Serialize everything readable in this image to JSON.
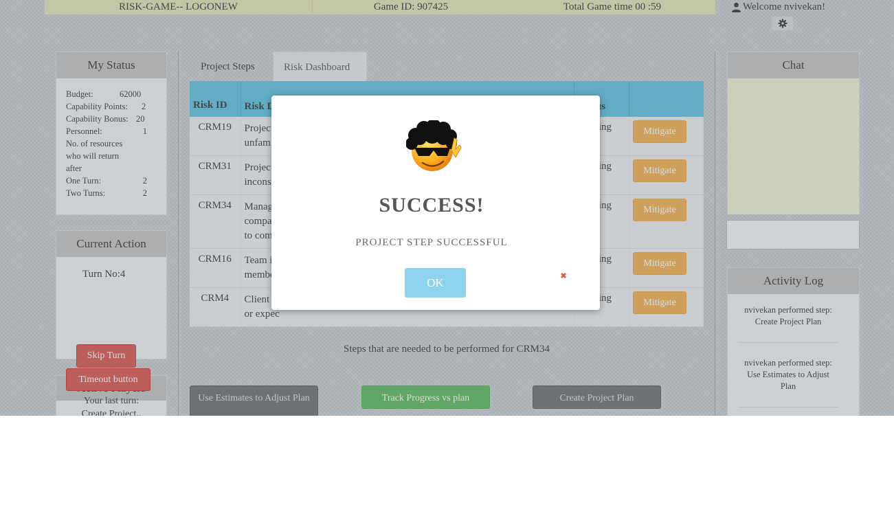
{
  "header": {
    "game_name": "RISK-GAME-- LOGONEW",
    "game_id": "Game ID: 907425",
    "total_time": "Total  Game  time  00 :59",
    "welcome": "Welcome   nvivekan!"
  },
  "tabs": [
    {
      "label": "Project  Steps"
    },
    {
      "label": "Risk Dashboard"
    }
  ],
  "my_status": {
    "title": "My Status",
    "budget_label": "Budget:",
    "budget_value": "62000",
    "capability_points_label": "Capability  Points:",
    "capability_points_value": "2",
    "capability_bonus_label": "Capability  Bonus:",
    "capability_bonus_value": "20",
    "personnel_label": "Personnel:",
    "personnel_value": "1",
    "resources_label": "No. of resources who will return after",
    "one_turn_label": "One Turn:",
    "one_turn_value": "2",
    "two_turns_label": "Two Turns:",
    "two_turns_value": "2"
  },
  "current_action": {
    "title": "Current   Action",
    "turn_no": "Turn  No:4",
    "skip_turn": "Skip Turn",
    "timeout_button": "Timeout   button"
  },
  "active_players": {
    "title": "Active Players",
    "last_turn_label": "Your last turn:",
    "last_turn_value": "Create  Project.."
  },
  "risk_table": {
    "headers": {
      "risk_id": "Risk ID",
      "risk_description": "Risk  De",
      "status": "Status"
    },
    "rows": [
      {
        "id": "CRM19",
        "description": "Project  t\nunfamilia",
        "status": "Pending",
        "action": "Mitigate"
      },
      {
        "id": "CRM31",
        "description": "Project  t\ninconsist",
        "status": "Pending",
        "action": "Mitigate"
      },
      {
        "id": "CRM34",
        "description": "Managem\ncompany\nto compa",
        "status": "Pending",
        "action": "Mitigate"
      },
      {
        "id": "CRM16",
        "description": "Team  is\nmembers",
        "status": "Pending",
        "action": "Mitigate"
      },
      {
        "id": "CRM4",
        "description": "Client  is\nor expec",
        "status": "Pending",
        "action": "Mitigate"
      }
    ]
  },
  "steps_needed": "Steps  that  are  needed  to  be  performed   for  CRM34",
  "step_buttons": [
    {
      "label": "Use Estimates  to Adjust Plan"
    },
    {
      "label": "Track  Progress  vs plan"
    },
    {
      "label": "Create  Project  Plan"
    }
  ],
  "chat": {
    "title": "Chat"
  },
  "activity_log": {
    "title": "Activity Log",
    "items": [
      {
        "text": "nvivekan  performed  step: Create Project Plan"
      },
      {
        "text": "nvivekan  performed  step: Use Estimates  to Adjust Plan"
      }
    ]
  },
  "modal": {
    "title": "SUCCESS!",
    "message": "PROJECT   STEP  SUCCESSFUL",
    "ok": "OK",
    "close": "✖"
  }
}
